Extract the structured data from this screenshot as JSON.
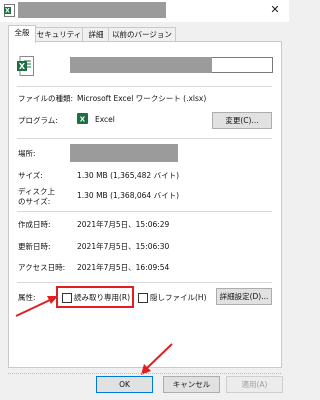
{
  "window": {
    "close_glyph": "✕"
  },
  "tabs": [
    {
      "label": "全般"
    },
    {
      "label": "セキュリティ"
    },
    {
      "label": "詳細"
    },
    {
      "label": "以前のバージョン"
    }
  ],
  "properties": {
    "file_type_label": "ファイルの種類:",
    "file_type_value": "Microsoft Excel ワークシート (.xlsx)",
    "program_label": "プログラム:",
    "program_value": "Excel",
    "change_button": "変更(C)...",
    "location_label": "場所:",
    "size_label": "サイズ:",
    "size_value": "1.30 MB (1,365,482 バイト)",
    "disk_size_label_1": "ディスク上",
    "disk_size_label_2": "のサイズ:",
    "disk_size_value": "1.30 MB (1,368,064 バイト)",
    "created_label": "作成日時:",
    "created_value": "2021年7月5日、15:06:29",
    "modified_label": "更新日時:",
    "modified_value": "2021年7月5日、15:06:30",
    "accessed_label": "アクセス日時:",
    "accessed_value": "2021年7月5日、16:09:54",
    "attributes_label": "属性:",
    "readonly_label": "読み取り専用(R)",
    "hidden_label": "隠しファイル(H)",
    "advanced_button": "詳細設定(D)..."
  },
  "footer": {
    "ok": "OK",
    "cancel": "キャンセル",
    "apply": "適用(A)"
  },
  "colors": {
    "annotation": "#e02020",
    "excel_green": "#1d6f42"
  },
  "icons": [
    "excel-file-icon",
    "excel-program-icon",
    "close-icon"
  ]
}
